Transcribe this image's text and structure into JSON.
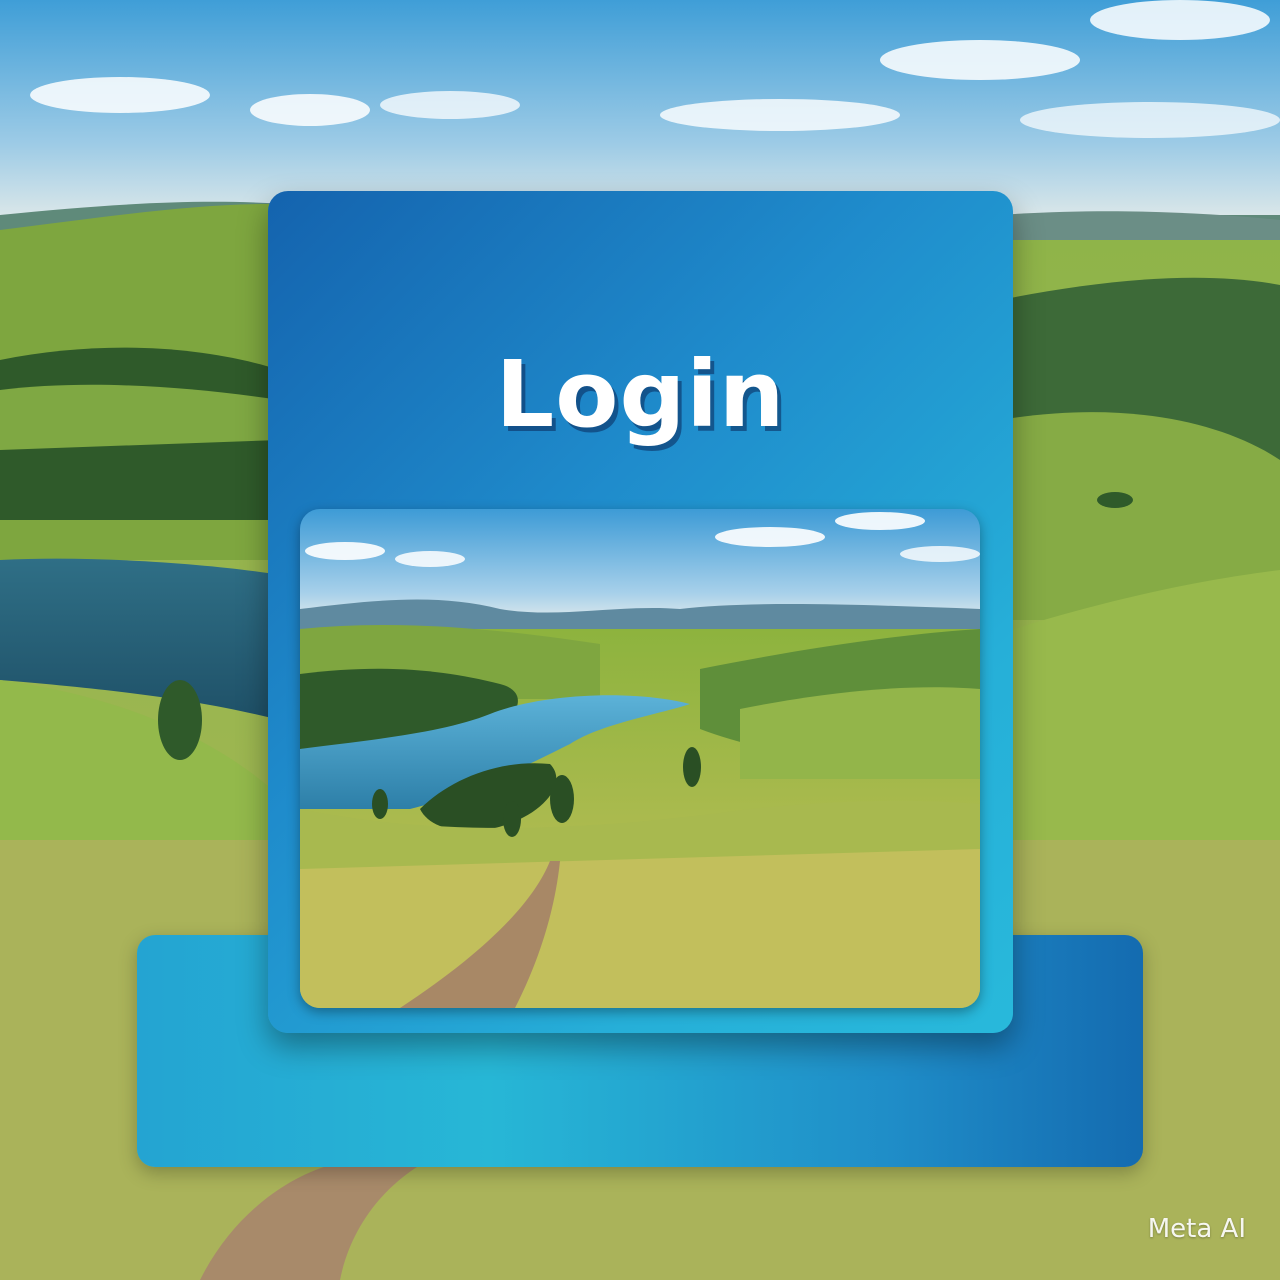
{
  "login_card": {
    "title": "Login"
  },
  "scene": {
    "background_photo": "rolling-hills-lake-landscape",
    "inner_photo": "valley-lake-path-landscape"
  },
  "watermark": {
    "text": "Meta AI"
  },
  "colors": {
    "card_gradient_start": "#1463ae",
    "card_gradient_end": "#28b9db",
    "base_bar": "#24a4d2",
    "title_text": "#ffffff"
  }
}
